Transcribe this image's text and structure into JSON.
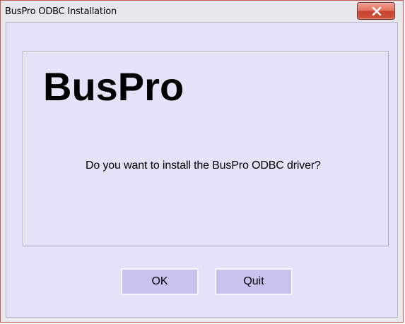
{
  "window": {
    "title": "BusPro ODBC Installation",
    "close_icon": "close-icon"
  },
  "dialog": {
    "logo_text": "BusPro",
    "message": "Do you want to install the BusPro ODBC driver?"
  },
  "buttons": {
    "ok_label": "OK",
    "quit_label": "Quit"
  },
  "colors": {
    "client_background": "#e3e2f6",
    "button_background": "#c6c4ef",
    "close_button": "#c6402a"
  }
}
